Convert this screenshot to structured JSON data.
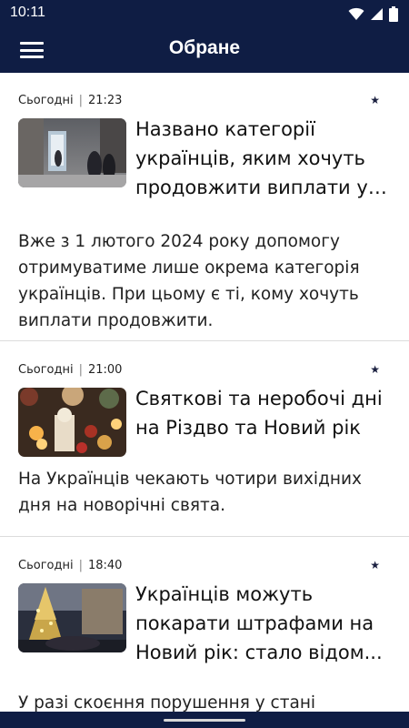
{
  "status_bar": {
    "time": "10:11",
    "icons": [
      "wifi-icon",
      "cellular-signal-icon",
      "battery-icon"
    ]
  },
  "app_bar": {
    "title": "Обране",
    "menu_icon": "hamburger-menu-icon"
  },
  "articles": [
    {
      "day": "Сьогодні",
      "time": "21:23",
      "headline": "Названо категорії українців, яким хочуть продовжити виплати у ...",
      "summary": "Вже з 1 лютого 2024 року допомогу отримуватиме лише окрема категорія українців. При цьому є ті, кому хочуть виплати продовжити.",
      "thumb": "street-night-snow-photo"
    },
    {
      "day": "Сьогодні",
      "time": "21:00",
      "headline": "Святкові та неробочі дні на Різдво та Новий рік",
      "summary": "На Українців чекають чотири вихідних дня на новорічні свята.",
      "thumb": "christmas-decor-photo"
    },
    {
      "day": "Сьогодні",
      "time": "18:40",
      "headline": "Українців можуть покарати штрафами на Новий рік: стало відом...",
      "summary": "У разі скоєння порушення у стані",
      "thumb": "christmas-tree-square-photo"
    }
  ],
  "colors": {
    "bar_background": "#0f1d44",
    "divider": "#dcdcdc",
    "text": "#111111"
  }
}
